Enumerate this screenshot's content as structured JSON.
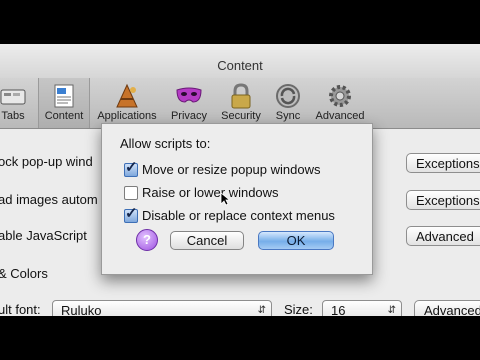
{
  "window": {
    "title": "Content"
  },
  "toolbar": {
    "items": [
      {
        "label": "Tabs",
        "icon": "tabs-icon"
      },
      {
        "label": "Content",
        "icon": "content-icon",
        "selected": true
      },
      {
        "label": "Applications",
        "icon": "applications-icon"
      },
      {
        "label": "Privacy",
        "icon": "privacy-mask-icon"
      },
      {
        "label": "Security",
        "icon": "padlock-icon"
      },
      {
        "label": "Sync",
        "icon": "sync-icon"
      },
      {
        "label": "Advanced",
        "icon": "gear-icon"
      }
    ]
  },
  "background_rows": {
    "row1_text": "ock pop-up wind",
    "row1_button": "Exceptions",
    "row2_text": "ad images autom",
    "row2_button": "Exceptions",
    "row3_text": "able JavaScript",
    "row3_button": "Advanced",
    "row4_text": "& Colors",
    "font_label": "ult font:",
    "font_value": "Ruluko",
    "size_label": "Size:",
    "size_value": "16",
    "font_advanced_button": "Advanced"
  },
  "dialog": {
    "heading": "Allow scripts to:",
    "options": [
      {
        "label": "Move or resize popup windows",
        "checked": true
      },
      {
        "label": "Raise or lower windows",
        "checked": false
      },
      {
        "label": "Disable or replace context menus",
        "checked": true
      }
    ],
    "help_label": "?",
    "cancel_label": "Cancel",
    "ok_label": "OK"
  },
  "colors": {
    "ok_button": "#76aee9",
    "help_button": "#9d51e0",
    "checkbox_checked": "#7fa8dc"
  }
}
